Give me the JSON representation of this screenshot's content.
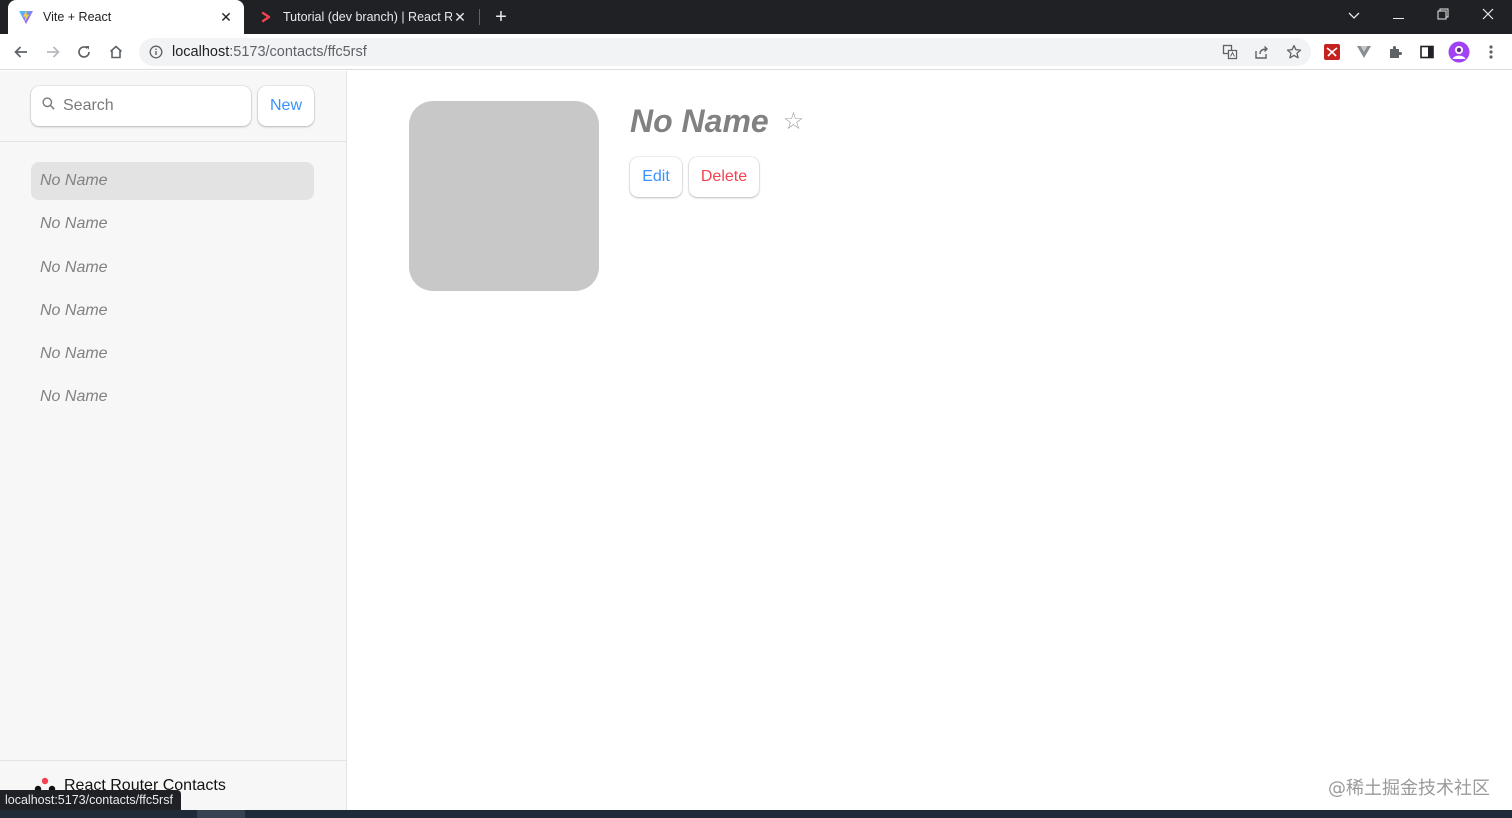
{
  "browser": {
    "tabs": [
      {
        "title": "Vite + React",
        "active": true
      },
      {
        "title": "Tutorial (dev branch) | React Router",
        "active": false
      }
    ],
    "url": {
      "host": "localhost",
      "rest": ":5173/contacts/ffc5rsf"
    },
    "status_url": "localhost:5173/contacts/ffc5rsf",
    "accent": "#3992ff"
  },
  "sidebar": {
    "search": {
      "placeholder": "Search",
      "value": ""
    },
    "new_label": "New",
    "contacts": [
      {
        "name": "No Name",
        "active": true
      },
      {
        "name": "No Name",
        "active": false
      },
      {
        "name": "No Name",
        "active": false
      },
      {
        "name": "No Name",
        "active": false
      },
      {
        "name": "No Name",
        "active": false
      },
      {
        "name": "No Name",
        "active": false
      }
    ],
    "footer_title": "React Router Contacts"
  },
  "contact": {
    "name": "No Name",
    "favorite_glyph": "☆",
    "edit_label": "Edit",
    "delete_label": "Delete",
    "delete_color": "#f44250"
  },
  "watermark": "@稀土掘金技术社区"
}
